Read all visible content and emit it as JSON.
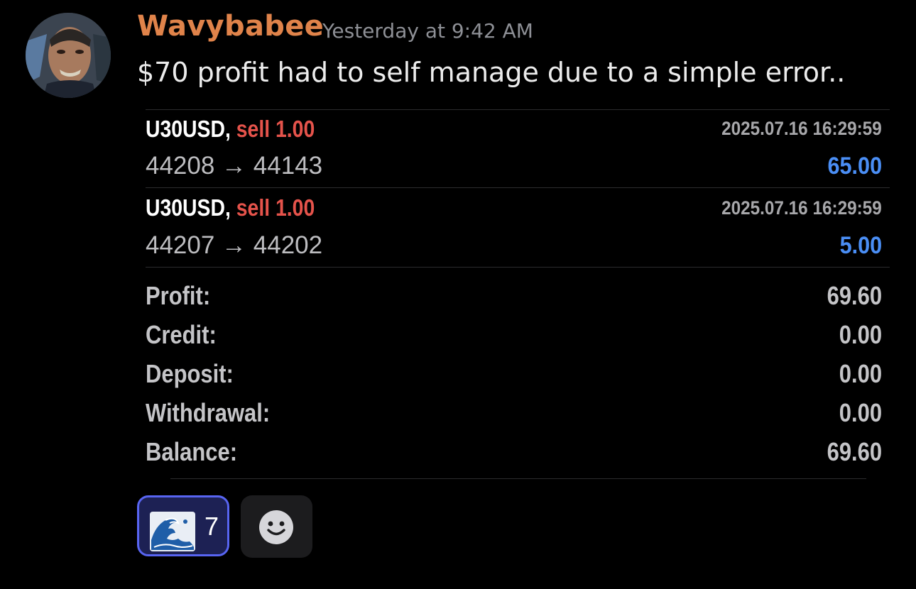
{
  "message": {
    "author": "Wavybabee",
    "timestamp": "Yesterday at 9:42 AM",
    "text": "$70 profit had to self manage due to a simple error..",
    "author_color": "#e0834a"
  },
  "trades": [
    {
      "symbol": "U30USD,",
      "side": "sell 1.00",
      "datetime": "2025.07.16 16:29:59",
      "prices": "44208 → 44143",
      "profit": "65.00"
    },
    {
      "symbol": "U30USD,",
      "side": "sell 1.00",
      "datetime": "2025.07.16 16:29:59",
      "prices": "44207 → 44202",
      "profit": "5.00"
    }
  ],
  "summary": [
    {
      "label": "Profit:",
      "value": "69.60"
    },
    {
      "label": "Credit:",
      "value": "0.00"
    },
    {
      "label": "Deposit:",
      "value": "0.00"
    },
    {
      "label": "Withdrawal:",
      "value": "0.00"
    },
    {
      "label": "Balance:",
      "value": "69.60"
    }
  ],
  "reactions": {
    "items": [
      {
        "emoji": "wave-emoji",
        "count": "7"
      }
    ],
    "add_icon": "add-reaction-smiley-icon"
  },
  "colors": {
    "sell": "#e5534b",
    "profit_positive": "#4a8ef5",
    "reaction_border": "#5865f2"
  }
}
